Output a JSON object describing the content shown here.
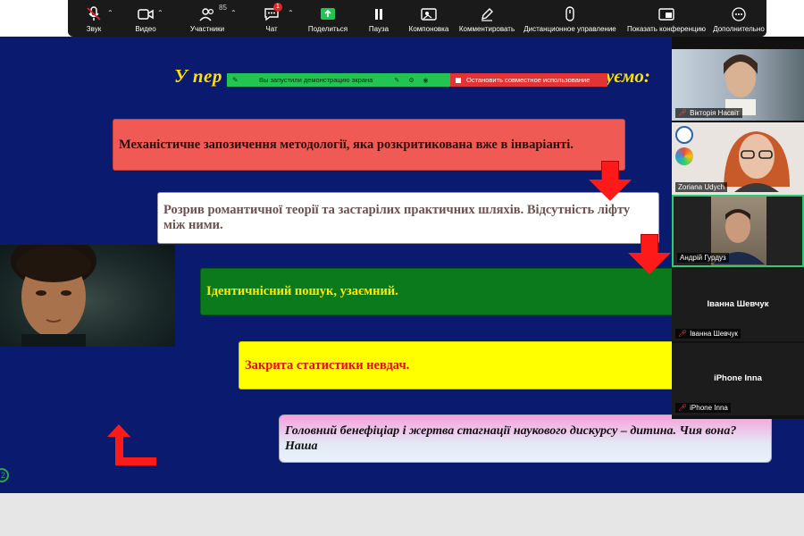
{
  "toolbar": {
    "items": [
      {
        "label": "Звук",
        "icon": "microphone-muted-icon"
      },
      {
        "label": "Видео",
        "icon": "video-camera-icon"
      },
      {
        "label": "Участники",
        "icon": "participants-icon",
        "count": "85"
      },
      {
        "label": "Чат",
        "icon": "chat-icon",
        "badge": "1"
      },
      {
        "label": "Поделиться",
        "icon": "share-screen-icon"
      },
      {
        "label": "Пауза",
        "icon": "pause-icon"
      },
      {
        "label": "Компоновка",
        "icon": "layout-icon"
      },
      {
        "label": "Комментировать",
        "icon": "annotate-pen-icon"
      },
      {
        "label": "Дистанционное управление",
        "icon": "remote-control-icon"
      },
      {
        "label": "Показать конференцию",
        "icon": "show-meeting-icon"
      },
      {
        "label": "Дополнительно",
        "icon": "more-icon"
      }
    ]
  },
  "share_banner": {
    "text": "Вы запустили демонстрацию экрана",
    "stop_label": "Остановить совместное использование",
    "color": "#23c552",
    "stop_color": "#e23434"
  },
  "slide": {
    "title_start": "У пер",
    "title_end": "уємо:",
    "boxes": [
      {
        "text": "Механістичне запозичення методології, яка розкритикована вже в інваріанті."
      },
      {
        "text": "Розрив романтичної теорії та застарілих практичних шляхів. Відсутність ліфту між ними."
      },
      {
        "text": "Ідентичнісний  пошук, узаємний."
      },
      {
        "text": "Закрита статистики невдач."
      },
      {
        "text": "Головний бенефіціар і жертва  стагнації наукового дискурсу – дитина. Чия вона?  Наша"
      }
    ],
    "background": "#0a1a6e",
    "mini_badge": "2"
  },
  "participants": [
    {
      "name": "Вікторія Насвіт",
      "muted": true
    },
    {
      "name": "Zoriana Udych",
      "muted": false
    },
    {
      "name": "Андрій Гурдуз",
      "muted": false
    },
    {
      "name": "Іванна Шевчук",
      "muted": true,
      "display": "Іванна Шевчук"
    },
    {
      "name": "iPhone Inna",
      "muted": true,
      "display": "iPhone Inna"
    }
  ]
}
